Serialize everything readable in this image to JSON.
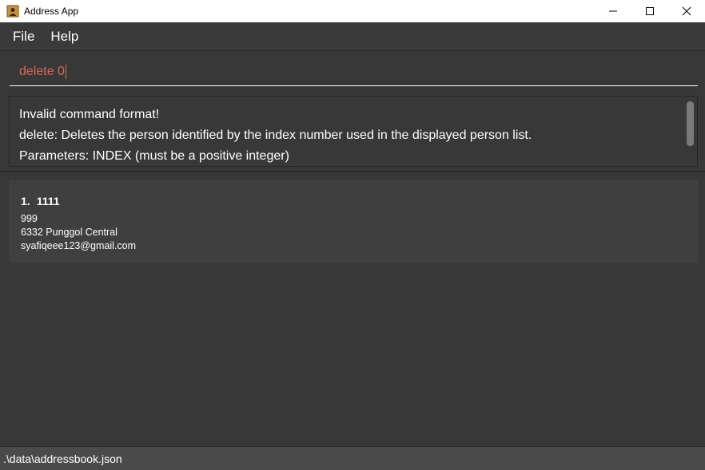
{
  "window": {
    "title": "Address App",
    "icon": "address-book-icon",
    "controls": [
      "minimize-icon",
      "maximize-icon",
      "close-icon"
    ]
  },
  "menu": {
    "items": [
      {
        "label": "File"
      },
      {
        "label": "Help"
      }
    ]
  },
  "command": {
    "value": "delete 0",
    "text_color": "#d86a55"
  },
  "result": {
    "lines": [
      "Invalid command format!",
      "delete: Deletes the person identified by the index number used in the displayed person list.",
      "Parameters: INDEX (must be a positive integer)"
    ]
  },
  "persons": [
    {
      "index": "1.",
      "name": "1111",
      "phone": "999",
      "address": "6332 Punggol Central",
      "email": "syafiqeee123@gmail.com"
    }
  ],
  "status": {
    "path": ".\\data\\addressbook.json"
  },
  "colors": {
    "background": "#383838",
    "card": "#3f3f3f",
    "statusbar": "#4a4a4a"
  }
}
